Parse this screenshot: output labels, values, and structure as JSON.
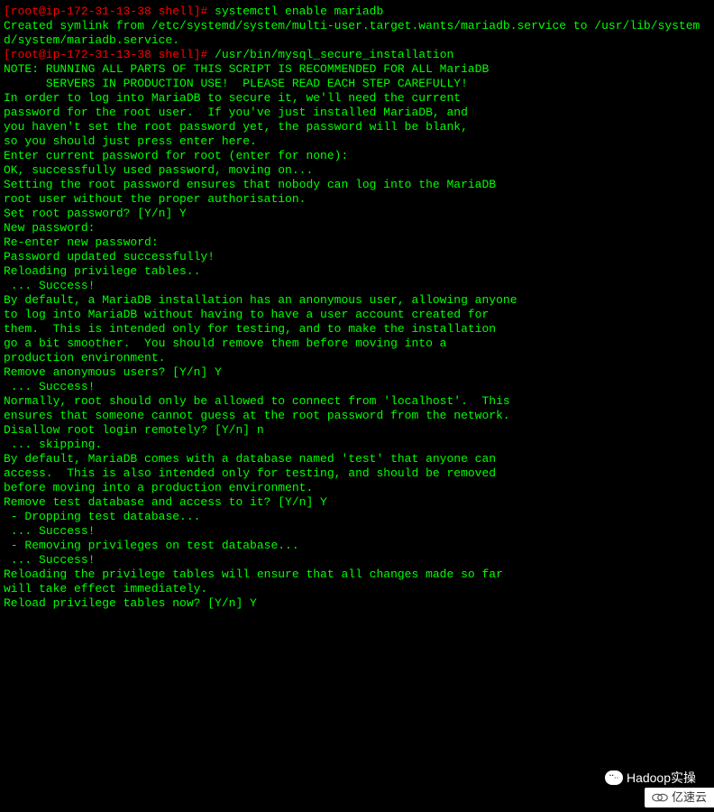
{
  "lines": [
    {
      "segments": [
        {
          "type": "prompt",
          "text": "[root@ip-172-31-13-38 shell]# "
        },
        {
          "type": "command",
          "text": "systemctl enable mariadb"
        }
      ]
    },
    {
      "segments": [
        {
          "type": "output",
          "text": "Created symlink from /etc/systemd/system/multi-user.target.wants/mariadb.service to /usr/lib/systemd/system/mariadb.service."
        }
      ]
    },
    {
      "segments": [
        {
          "type": "prompt",
          "text": "[root@ip-172-31-13-38 shell]# "
        },
        {
          "type": "command",
          "text": "/usr/bin/mysql_secure_installation"
        }
      ]
    },
    {
      "segments": [
        {
          "type": "output",
          "text": ""
        }
      ]
    },
    {
      "segments": [
        {
          "type": "output",
          "text": "NOTE: RUNNING ALL PARTS OF THIS SCRIPT IS RECOMMENDED FOR ALL MariaDB"
        }
      ]
    },
    {
      "segments": [
        {
          "type": "output",
          "text": "      SERVERS IN PRODUCTION USE!  PLEASE READ EACH STEP CAREFULLY!"
        }
      ]
    },
    {
      "segments": [
        {
          "type": "output",
          "text": ""
        }
      ]
    },
    {
      "segments": [
        {
          "type": "output",
          "text": "In order to log into MariaDB to secure it, we'll need the current"
        }
      ]
    },
    {
      "segments": [
        {
          "type": "output",
          "text": "password for the root user.  If you've just installed MariaDB, and"
        }
      ]
    },
    {
      "segments": [
        {
          "type": "output",
          "text": "you haven't set the root password yet, the password will be blank,"
        }
      ]
    },
    {
      "segments": [
        {
          "type": "output",
          "text": "so you should just press enter here."
        }
      ]
    },
    {
      "segments": [
        {
          "type": "output",
          "text": ""
        }
      ]
    },
    {
      "segments": [
        {
          "type": "output",
          "text": "Enter current password for root (enter for none):"
        }
      ]
    },
    {
      "segments": [
        {
          "type": "output",
          "text": "OK, successfully used password, moving on..."
        }
      ]
    },
    {
      "segments": [
        {
          "type": "output",
          "text": ""
        }
      ]
    },
    {
      "segments": [
        {
          "type": "output",
          "text": "Setting the root password ensures that nobody can log into the MariaDB"
        }
      ]
    },
    {
      "segments": [
        {
          "type": "output",
          "text": "root user without the proper authorisation."
        }
      ]
    },
    {
      "segments": [
        {
          "type": "output",
          "text": ""
        }
      ]
    },
    {
      "segments": [
        {
          "type": "output",
          "text": "Set root password? [Y/n] Y"
        }
      ]
    },
    {
      "segments": [
        {
          "type": "output",
          "text": "New password:"
        }
      ]
    },
    {
      "segments": [
        {
          "type": "output",
          "text": "Re-enter new password:"
        }
      ]
    },
    {
      "segments": [
        {
          "type": "output",
          "text": "Password updated successfully!"
        }
      ]
    },
    {
      "segments": [
        {
          "type": "output",
          "text": "Reloading privilege tables.."
        }
      ]
    },
    {
      "segments": [
        {
          "type": "output",
          "text": " ... Success!"
        }
      ]
    },
    {
      "segments": [
        {
          "type": "output",
          "text": ""
        }
      ]
    },
    {
      "segments": [
        {
          "type": "output",
          "text": ""
        }
      ]
    },
    {
      "segments": [
        {
          "type": "output",
          "text": "By default, a MariaDB installation has an anonymous user, allowing anyone"
        }
      ]
    },
    {
      "segments": [
        {
          "type": "output",
          "text": "to log into MariaDB without having to have a user account created for"
        }
      ]
    },
    {
      "segments": [
        {
          "type": "output",
          "text": "them.  This is intended only for testing, and to make the installation"
        }
      ]
    },
    {
      "segments": [
        {
          "type": "output",
          "text": "go a bit smoother.  You should remove them before moving into a"
        }
      ]
    },
    {
      "segments": [
        {
          "type": "output",
          "text": "production environment."
        }
      ]
    },
    {
      "segments": [
        {
          "type": "output",
          "text": ""
        }
      ]
    },
    {
      "segments": [
        {
          "type": "output",
          "text": "Remove anonymous users? [Y/n] Y"
        }
      ]
    },
    {
      "segments": [
        {
          "type": "output",
          "text": " ... Success!"
        }
      ]
    },
    {
      "segments": [
        {
          "type": "output",
          "text": ""
        }
      ]
    },
    {
      "segments": [
        {
          "type": "output",
          "text": "Normally, root should only be allowed to connect from 'localhost'.  This"
        }
      ]
    },
    {
      "segments": [
        {
          "type": "output",
          "text": "ensures that someone cannot guess at the root password from the network."
        }
      ]
    },
    {
      "segments": [
        {
          "type": "output",
          "text": ""
        }
      ]
    },
    {
      "segments": [
        {
          "type": "output",
          "text": "Disallow root login remotely? [Y/n] n"
        }
      ]
    },
    {
      "segments": [
        {
          "type": "output",
          "text": " ... skipping."
        }
      ]
    },
    {
      "segments": [
        {
          "type": "output",
          "text": ""
        }
      ]
    },
    {
      "segments": [
        {
          "type": "output",
          "text": "By default, MariaDB comes with a database named 'test' that anyone can"
        }
      ]
    },
    {
      "segments": [
        {
          "type": "output",
          "text": "access.  This is also intended only for testing, and should be removed"
        }
      ]
    },
    {
      "segments": [
        {
          "type": "output",
          "text": "before moving into a production environment."
        }
      ]
    },
    {
      "segments": [
        {
          "type": "output",
          "text": ""
        }
      ]
    },
    {
      "segments": [
        {
          "type": "output",
          "text": "Remove test database and access to it? [Y/n] Y"
        }
      ]
    },
    {
      "segments": [
        {
          "type": "output",
          "text": " - Dropping test database..."
        }
      ]
    },
    {
      "segments": [
        {
          "type": "output",
          "text": " ... Success!"
        }
      ]
    },
    {
      "segments": [
        {
          "type": "output",
          "text": " - Removing privileges on test database..."
        }
      ]
    },
    {
      "segments": [
        {
          "type": "output",
          "text": " ... Success!"
        }
      ]
    },
    {
      "segments": [
        {
          "type": "output",
          "text": ""
        }
      ]
    },
    {
      "segments": [
        {
          "type": "output",
          "text": "Reloading the privilege tables will ensure that all changes made so far"
        }
      ]
    },
    {
      "segments": [
        {
          "type": "output",
          "text": "will take effect immediately."
        }
      ]
    },
    {
      "segments": [
        {
          "type": "output",
          "text": ""
        }
      ]
    },
    {
      "segments": [
        {
          "type": "output",
          "text": "Reload privilege tables now? [Y/n] Y"
        }
      ]
    }
  ],
  "watermark1": "Hadoop实操",
  "watermark2": "亿速云"
}
